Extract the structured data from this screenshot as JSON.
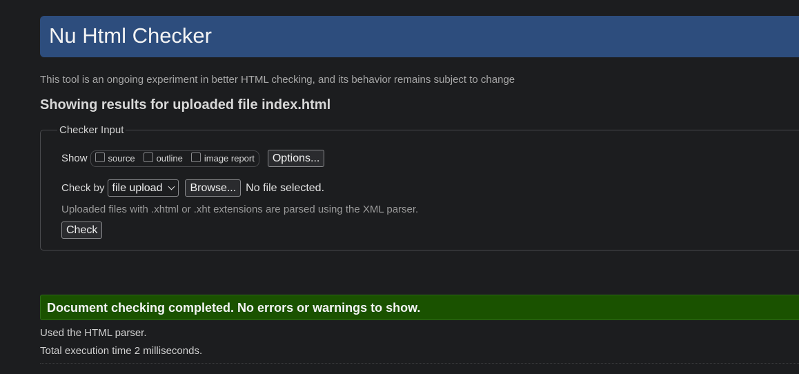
{
  "header": {
    "title": "Nu Html Checker"
  },
  "intro": "This tool is an ongoing experiment in better HTML checking, and its behavior remains subject to change",
  "results_heading": "Showing results for uploaded file index.html",
  "checker_input": {
    "legend": "Checker Input",
    "show_label": "Show",
    "show_options": [
      {
        "label": "source",
        "checked": false
      },
      {
        "label": "outline",
        "checked": false
      },
      {
        "label": "image report",
        "checked": false
      }
    ],
    "options_button": "Options...",
    "check_by_label": "Check by",
    "check_by_value": "file upload",
    "browse_button": "Browse...",
    "file_status": "No file selected.",
    "hint": "Uploaded files with .xhtml or .xht extensions are parsed using the XML parser.",
    "check_button": "Check"
  },
  "result": {
    "message": "Document checking completed. No errors or warnings to show.",
    "parser_info": "Used the HTML parser.",
    "timing_info": "Total execution time 2 milliseconds."
  },
  "colors": {
    "background": "#1c1d1f",
    "header": "#2d4d7d",
    "success": "#1a5200"
  }
}
